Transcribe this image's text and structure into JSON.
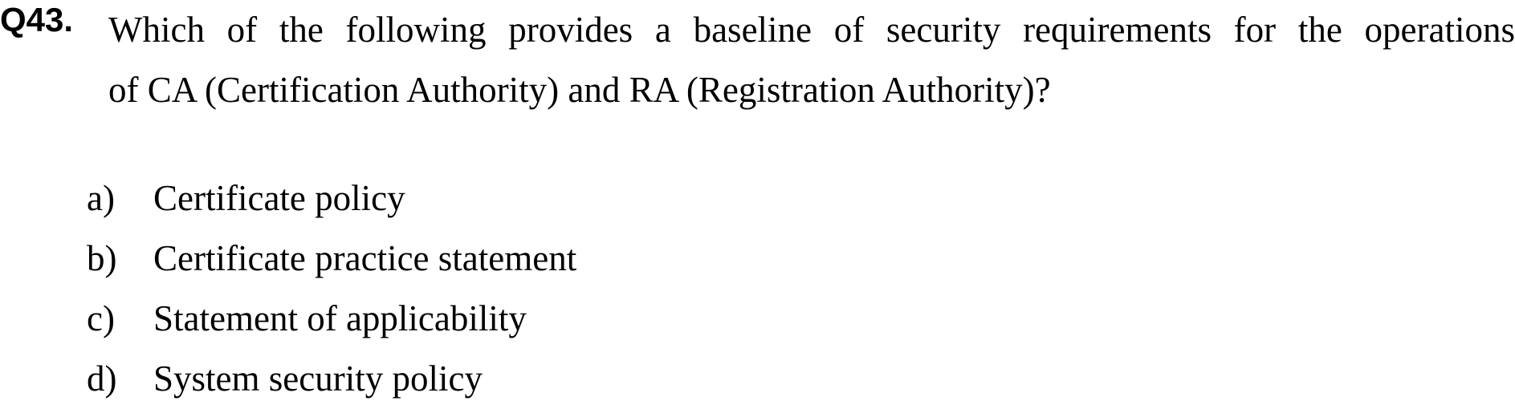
{
  "question": {
    "number": "Q43.",
    "lines": [
      "Which of the following provides a baseline of security requirements for the operations",
      "of CA (Certification Authority) and RA (Registration Authority)?"
    ]
  },
  "options": [
    {
      "letter": "a)",
      "text": "Certificate policy"
    },
    {
      "letter": "b)",
      "text": "Certificate practice statement"
    },
    {
      "letter": "c)",
      "text": "Statement of applicability"
    },
    {
      "letter": "d)",
      "text": "System security policy"
    }
  ]
}
